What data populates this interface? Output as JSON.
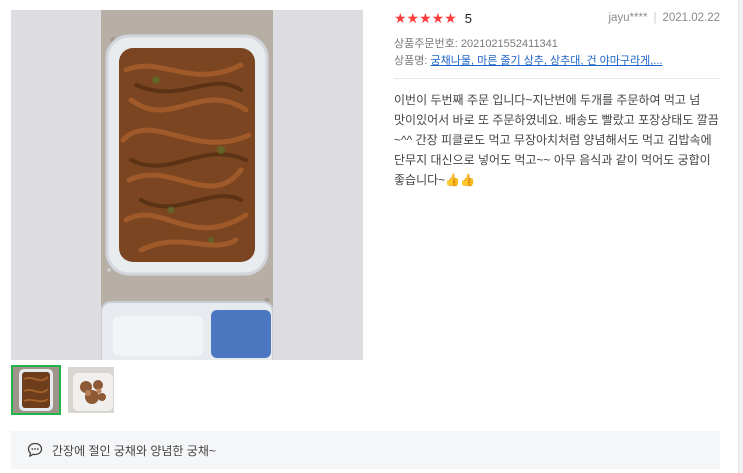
{
  "review": {
    "stars": "★★★★★",
    "score": "5",
    "user": "jayu****",
    "date": "2021.02.22",
    "order_label": "상품주문번호:",
    "order_number": "2021021552411341",
    "product_label": "상품명:",
    "product_name": "궁채나물, 마른 줄기 상추, 상추대, 건 야마구라게,...",
    "text": "이번이 두번째 주문 입니다~지난번에 두개를 주문하여 먹고 넘 맛이있어서 바로 또 주문하였네요. 배송도 빨랐고 포장상태도 깔끔~^^ 간장 피클로도 먹고 무장아치처럼 양념해서도 먹고 김밥속에 단무지 대신으로 넣어도 먹고~~ 아무 음식과 같이 먹어도 궁합이 좋습니다~",
    "emoji": "👍👍"
  },
  "comment": {
    "icon": "speech-bubble-icon",
    "text": "간장에 절인 궁채와 양념한 궁채~"
  },
  "colors": {
    "star": "#ff3c3c",
    "link": "#1b63c6",
    "active_thumb_border": "#24b24b"
  }
}
